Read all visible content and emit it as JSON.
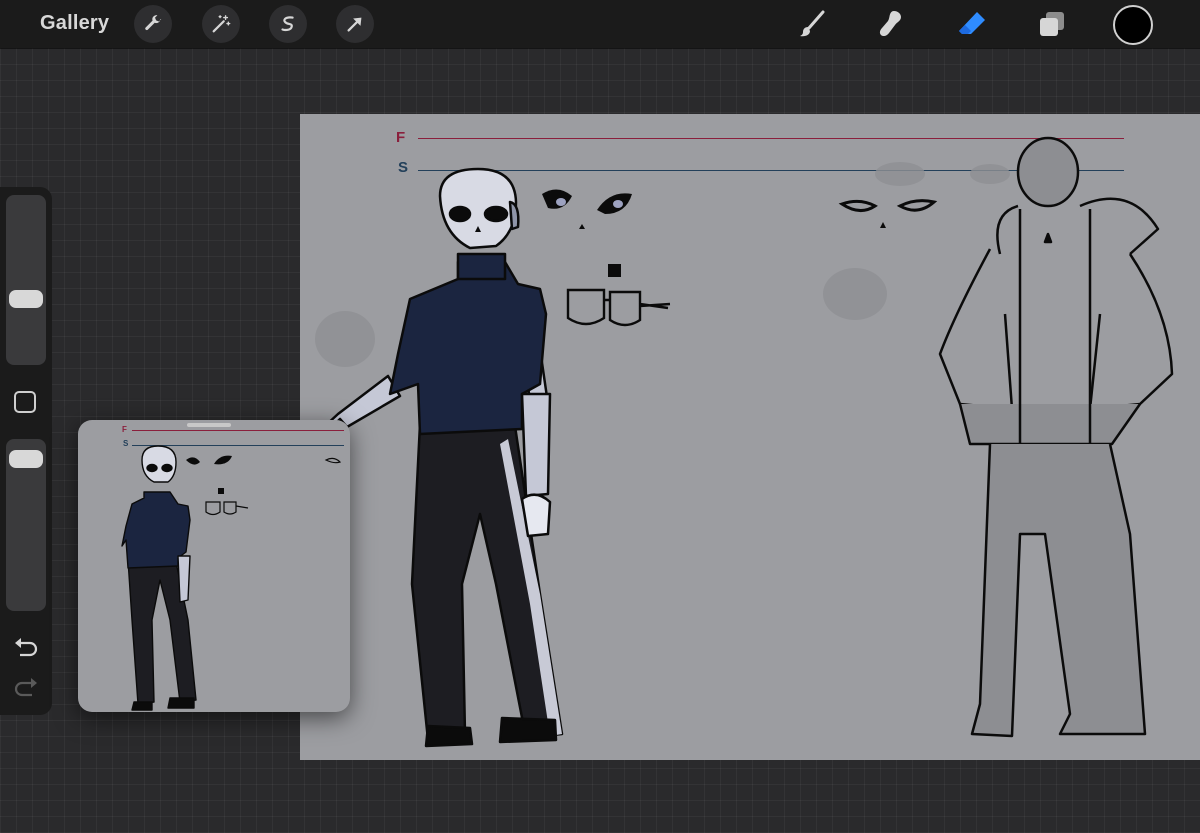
{
  "topbar": {
    "gallery_label": "Gallery",
    "left_tools": [
      "wrench-icon",
      "magic-wand-icon",
      "selection-icon",
      "transform-arrow-icon"
    ],
    "right_tools": [
      "brush-icon",
      "smudge-icon",
      "eraser-icon",
      "layers-icon"
    ],
    "active_tool": "eraser-icon",
    "current_color": "#000000",
    "accent_color": "#2f8cff"
  },
  "sidebar": {
    "brush_size_level": 0.37,
    "opacity_level": 0.05,
    "icons": [
      "modify-square-icon",
      "undo-icon",
      "redo-icon"
    ]
  },
  "canvas": {
    "background_color": "#9c9da1",
    "guides": [
      {
        "label": "F",
        "color": "#8a1f3c"
      },
      {
        "label": "S",
        "color": "#23405a"
      }
    ]
  },
  "reference_window": {
    "guides": [
      {
        "label": "F",
        "color": "#8a1f3c"
      },
      {
        "label": "S",
        "color": "#23405a"
      }
    ]
  }
}
